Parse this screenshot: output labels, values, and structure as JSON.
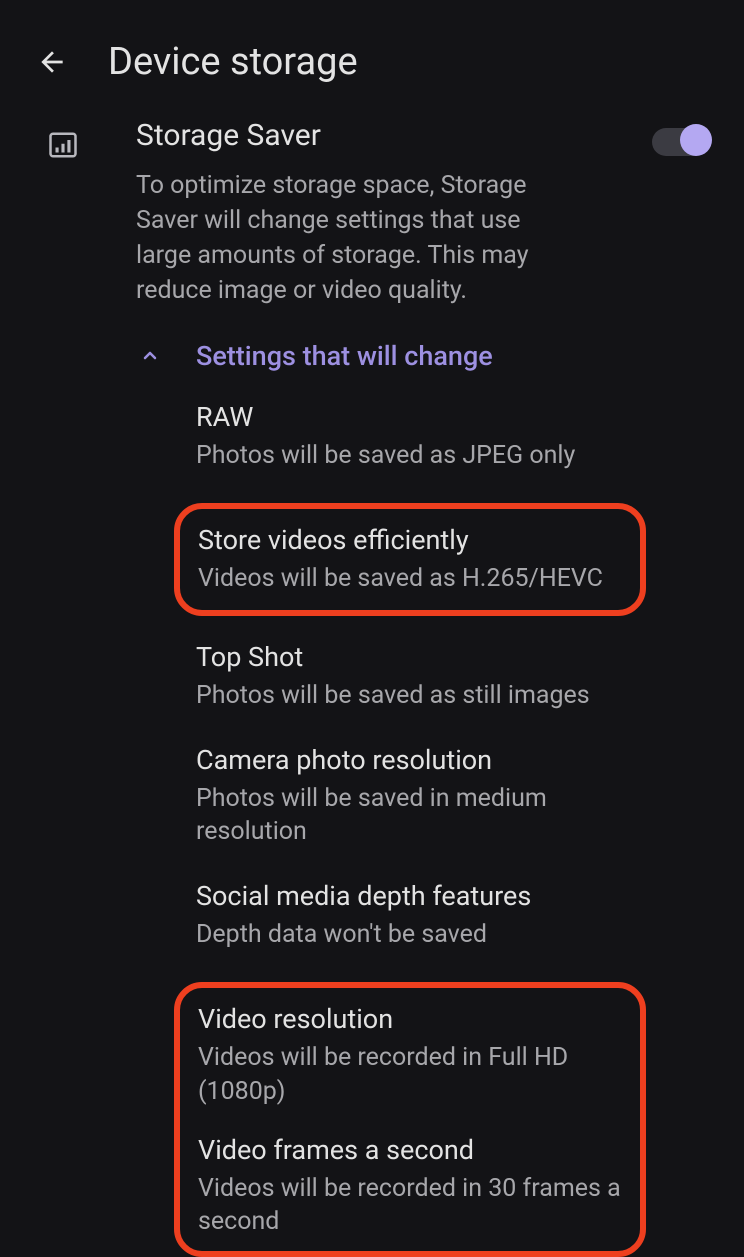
{
  "header": {
    "title": "Device storage"
  },
  "storageSaver": {
    "title": "Storage Saver",
    "description": "To optimize storage space, Storage Saver will change settings that use large amounts of storage. This may reduce image or video quality."
  },
  "collapsible": {
    "label": "Settings that will change"
  },
  "items": {
    "raw": {
      "title": "RAW",
      "desc": "Photos will be saved as JPEG only"
    },
    "storeVideos": {
      "title": "Store videos efficiently",
      "desc": "Videos will be saved as H.265/HEVC"
    },
    "topShot": {
      "title": "Top Shot",
      "desc": "Photos will be saved as still images"
    },
    "photoRes": {
      "title": "Camera photo resolution",
      "desc": "Photos will be saved in medium resolution"
    },
    "depth": {
      "title": "Social media depth features",
      "desc": "Depth data won't be saved"
    },
    "videoRes": {
      "title": "Video resolution",
      "desc": "Videos will be recorded in Full HD (1080p)"
    },
    "fps": {
      "title": "Video frames a second",
      "desc": "Videos will be recorded in 30 frames a second"
    }
  }
}
